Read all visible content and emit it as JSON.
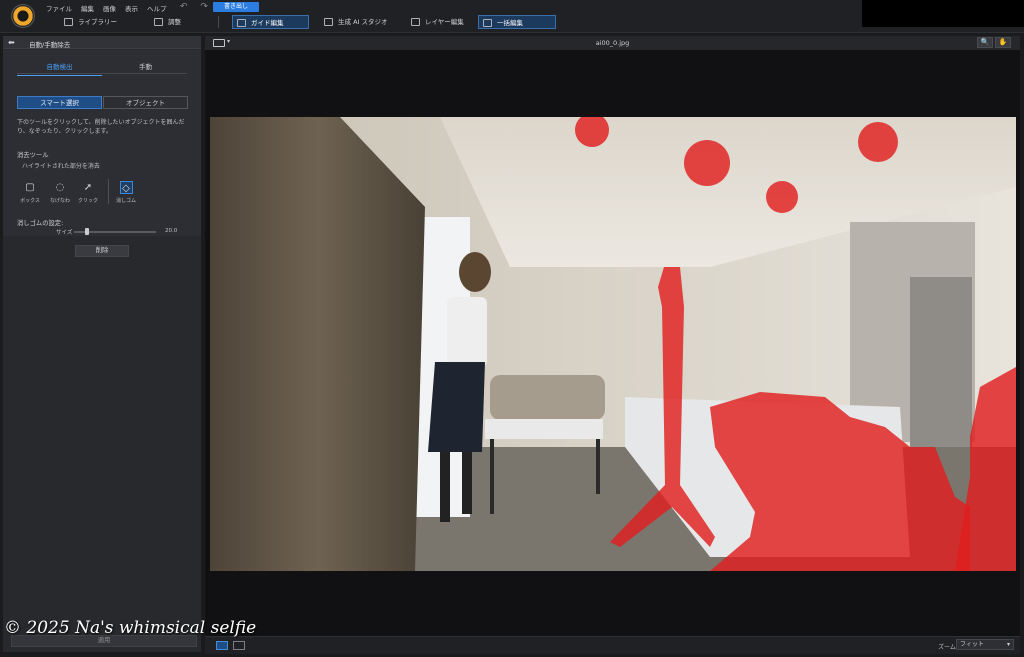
{
  "menu": [
    "ファイル",
    "編集",
    "画像",
    "表示",
    "ヘルプ"
  ],
  "undo_redo": "↶ ↷",
  "export_button": "書き出し",
  "modes": {
    "library": "ライブラリー",
    "adjust": "調整",
    "guided_edit": "ガイド編集",
    "ai_studio": "生成 AI スタジオ",
    "layer_edit": "レイヤー編集",
    "batch_edit": "一括編集"
  },
  "panel": {
    "title": "自動/手動除去",
    "tabs": [
      "自動検出",
      "手動"
    ],
    "segments": [
      "スマート選択",
      "オブジェクト"
    ],
    "description": "下のツールをクリックして、削除したいオブジェクトを囲んだり、なぞったり、クリックします。",
    "eraser_tool_label": "消去ツール",
    "eraser_tool_sub": "ハイライトされた部分を消去",
    "tools": [
      {
        "label": "ボックス",
        "icon": "box-select-icon"
      },
      {
        "label": "なげなわ",
        "icon": "lasso-icon"
      },
      {
        "label": "クリック",
        "icon": "click-pointer-icon"
      },
      {
        "label": "消しゴム",
        "icon": "eraser-icon"
      }
    ],
    "eraser_settings_label": "消しゴムの設定:",
    "size_label": "サイズ",
    "size_value": "20.0",
    "size_fraction": 0.14,
    "delete_button": "削除",
    "apply_button": "適用"
  },
  "viewer": {
    "filename": "ai00_0.jpg",
    "zoom_label": "ズーム",
    "zoom_value": "フィット"
  },
  "watermark": "© 2025 Na's whimsical selfie",
  "colors": {
    "accent": "#2b7de0",
    "highlight_mask": "#e01f1f"
  }
}
